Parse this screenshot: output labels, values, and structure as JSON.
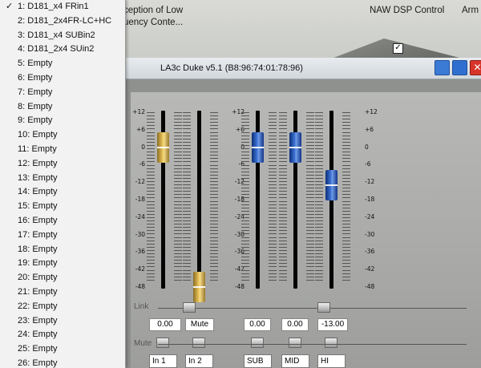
{
  "desktop": {
    "icon_label_1_line1": "ception of Low",
    "icon_label_1_line2": "uency Conte...",
    "icon_label_2": "NAW DSP Control",
    "icon_label_3": "Arm",
    "tray_icon": "checkbox-icon"
  },
  "menu": {
    "items": [
      {
        "label": "1: D181_x4 FRin1",
        "checked": true
      },
      {
        "label": "2: D181_2x4FR-LC+HC"
      },
      {
        "label": "3: D181_x4 SUBin2"
      },
      {
        "label": "4: D181_2x4 SUin2"
      },
      {
        "label": "5: Empty"
      },
      {
        "label": "6: Empty"
      },
      {
        "label": "7: Empty"
      },
      {
        "label": "8: Empty"
      },
      {
        "label": "9: Empty"
      },
      {
        "label": "10: Empty"
      },
      {
        "label": "11: Empty"
      },
      {
        "label": "12: Empty"
      },
      {
        "label": "13: Empty"
      },
      {
        "label": "14: Empty"
      },
      {
        "label": "15: Empty"
      },
      {
        "label": "16: Empty"
      },
      {
        "label": "17: Empty"
      },
      {
        "label": "18: Empty"
      },
      {
        "label": "19: Empty"
      },
      {
        "label": "20: Empty"
      },
      {
        "label": "21: Empty"
      },
      {
        "label": "22: Empty"
      },
      {
        "label": "23: Empty"
      },
      {
        "label": "24: Empty"
      },
      {
        "label": "25: Empty"
      },
      {
        "label": "26: Empty"
      }
    ],
    "check_glyph": "✓"
  },
  "window": {
    "title": "LA3c Duke v5.1 (B8:96:74:01:78:96)"
  },
  "mixer": {
    "scale_ticks": [
      "+12",
      "+6",
      "0",
      "-6",
      "-12",
      "-18",
      "-24",
      "-30",
      "-36",
      "-42",
      "-48"
    ],
    "link_label": "Link",
    "mute_label": "Mute",
    "channels": [
      {
        "name": "In 1",
        "value": "0.00",
        "color": "yellow",
        "level_db": 0
      },
      {
        "name": "In 2",
        "value": "Mute",
        "color": "yellow",
        "level_db": -48
      },
      {
        "name": "SUB",
        "value": "0.00",
        "color": "blue",
        "level_db": 0
      },
      {
        "name": "MID",
        "value": "0.00",
        "color": "blue",
        "level_db": 0
      },
      {
        "name": "HI",
        "value": "-13.00",
        "color": "blue",
        "level_db": -13
      }
    ]
  }
}
